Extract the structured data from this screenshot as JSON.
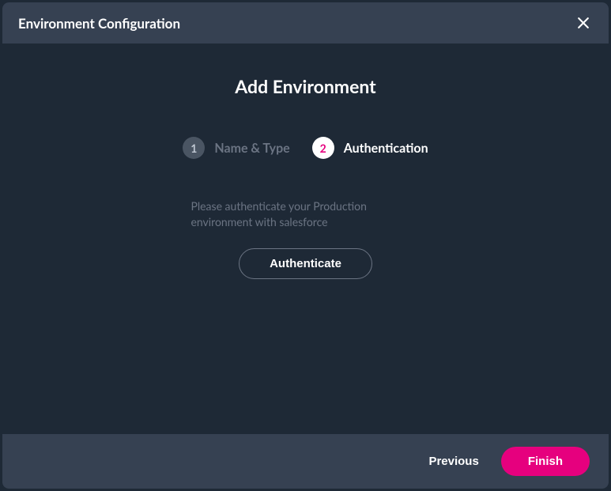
{
  "header": {
    "title": "Environment Configuration"
  },
  "page": {
    "title": "Add Environment"
  },
  "stepper": {
    "steps": [
      {
        "number": "1",
        "label": "Name & Type",
        "active": false
      },
      {
        "number": "2",
        "label": "Authentication",
        "active": true
      }
    ]
  },
  "instruction": "Please authenticate your Production environment with salesforce",
  "authenticate_label": "Authenticate",
  "footer": {
    "previous_label": "Previous",
    "finish_label": "Finish"
  }
}
